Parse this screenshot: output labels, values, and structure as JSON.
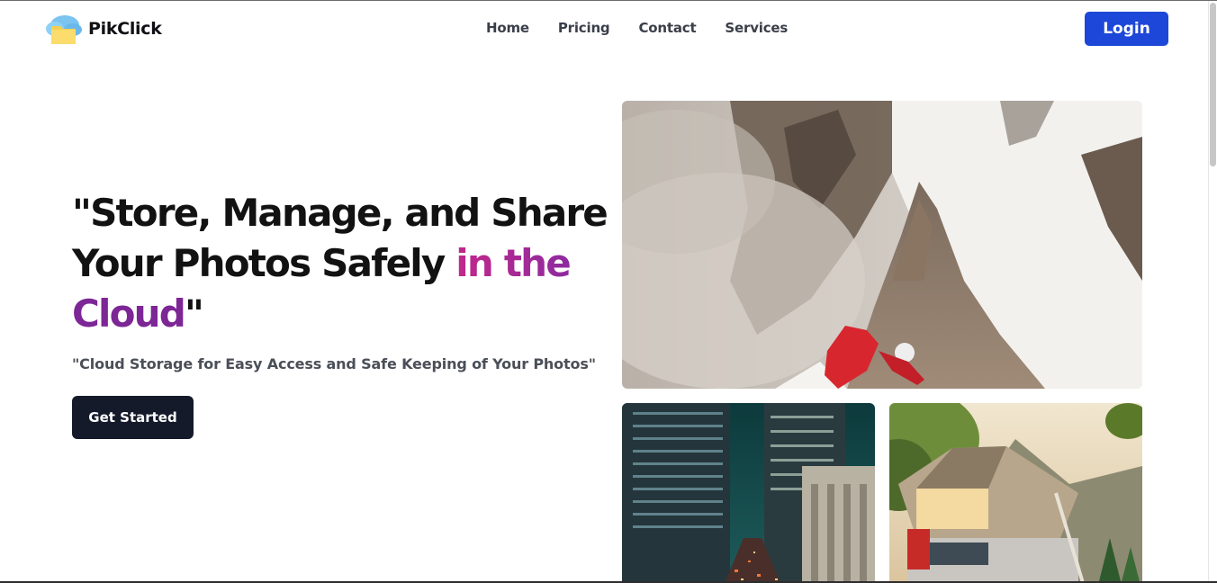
{
  "brand": {
    "name": "PikClick",
    "logo_icon": "cloud-folder-icon",
    "colors": {
      "primary": "#1d47d8",
      "dark": "#141a2a",
      "accent_pink": "#c2288a",
      "accent_purple": "#7d2696"
    }
  },
  "nav": {
    "items": [
      {
        "label": "Home"
      },
      {
        "label": "Pricing"
      },
      {
        "label": "Contact"
      },
      {
        "label": "Services"
      }
    ],
    "login_label": "Login"
  },
  "hero": {
    "title_part1": "\"Store, Manage, and Share Your Photos Safely ",
    "title_highlight1": "in the",
    "title_highlight2": "Cloud",
    "title_end": "\"",
    "subtitle": "\"Cloud Storage for Easy Access and Safe Keeping of Your Photos\"",
    "cta_label": "Get Started"
  },
  "gallery": {
    "images": [
      {
        "name": "mountain-climber-photo"
      },
      {
        "name": "city-night-photo"
      },
      {
        "name": "rooftop-tent-photo"
      }
    ]
  }
}
